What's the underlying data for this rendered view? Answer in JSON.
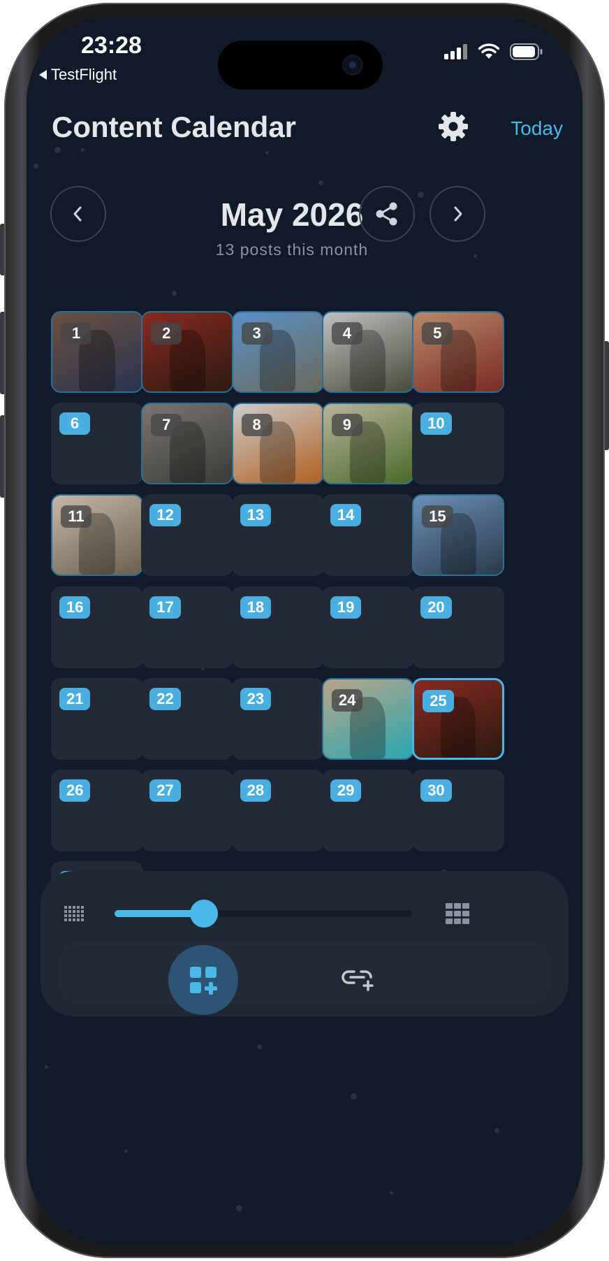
{
  "status": {
    "time": "23:28",
    "back_app": "TestFlight"
  },
  "header": {
    "title": "Content Calendar",
    "today_label": "Today"
  },
  "month": {
    "title": "May 2026",
    "subtitle": "13 posts this month"
  },
  "calendar": {
    "days": [
      {
        "day": "1",
        "photo": true,
        "colors": [
          "#6a5040",
          "#2a3450"
        ]
      },
      {
        "day": "2",
        "photo": true,
        "colors": [
          "#8a2a22",
          "#2a1a10"
        ]
      },
      {
        "day": "3",
        "photo": true,
        "colors": [
          "#5a90c8",
          "#6a6a5a"
        ]
      },
      {
        "day": "4",
        "photo": true,
        "colors": [
          "#c0c0c0",
          "#4a4a3a"
        ]
      },
      {
        "day": "5",
        "photo": true,
        "colors": [
          "#b88a6a",
          "#7a2a22"
        ]
      },
      {
        "day": "6",
        "photo": false
      },
      {
        "day": "7",
        "photo": true,
        "colors": [
          "#7a7670",
          "#3a3a38"
        ]
      },
      {
        "day": "8",
        "photo": true,
        "colors": [
          "#cccccc",
          "#b06020"
        ]
      },
      {
        "day": "9",
        "photo": true,
        "colors": [
          "#b8b49a",
          "#4a6a2a"
        ]
      },
      {
        "day": "10",
        "photo": false
      },
      {
        "day": "11",
        "photo": true,
        "colors": [
          "#c4b8a8",
          "#6a6050"
        ]
      },
      {
        "day": "12",
        "photo": false
      },
      {
        "day": "13",
        "photo": false
      },
      {
        "day": "14",
        "photo": false
      },
      {
        "day": "15",
        "photo": true,
        "colors": [
          "#6a90b8",
          "#2a3a4a"
        ]
      },
      {
        "day": "16",
        "photo": false
      },
      {
        "day": "17",
        "photo": false
      },
      {
        "day": "18",
        "photo": false
      },
      {
        "day": "19",
        "photo": false
      },
      {
        "day": "20",
        "photo": false
      },
      {
        "day": "21",
        "photo": false
      },
      {
        "day": "22",
        "photo": false
      },
      {
        "day": "23",
        "photo": false
      },
      {
        "day": "24",
        "photo": true,
        "colors": [
          "#b8a488",
          "#2aa8b0"
        ]
      },
      {
        "day": "25",
        "photo": true,
        "colors": [
          "#8a2a22",
          "#2a1a10"
        ],
        "selected": true
      },
      {
        "day": "26",
        "photo": false
      },
      {
        "day": "27",
        "photo": false
      },
      {
        "day": "28",
        "photo": false
      },
      {
        "day": "29",
        "photo": false
      },
      {
        "day": "30",
        "photo": false
      },
      {
        "day": "31",
        "photo": false
      }
    ]
  },
  "zoom": {
    "level": 0.3
  },
  "colors": {
    "accent": "#4ab9ea",
    "background": "#111a28",
    "cell": "#232a36"
  },
  "icons": {
    "settings": "gear-icon",
    "prev": "chevron-left-icon",
    "next": "chevron-right-icon",
    "share": "share-icon",
    "zoom_out": "small-grid-icon",
    "zoom_in": "large-grid-icon",
    "add_grid": "add-grid-icon",
    "add_link": "link-add-icon"
  }
}
